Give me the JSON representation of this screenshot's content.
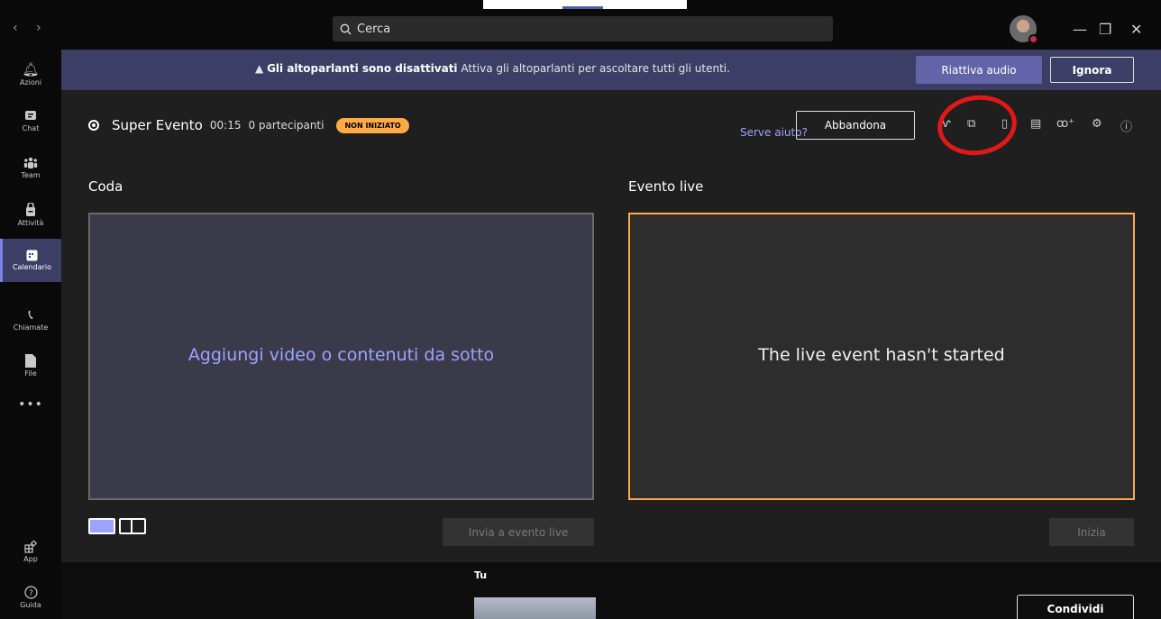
{
  "search": {
    "placeholder": "Cerca"
  },
  "nav": {
    "back": "‹",
    "forward": "›"
  },
  "window": {
    "minimize": "—",
    "maximize": "❐",
    "close": "✕"
  },
  "rail": {
    "items": [
      {
        "label": "Azioni",
        "icon": "bell-icon"
      },
      {
        "label": "Chat",
        "icon": "chat-icon"
      },
      {
        "label": "Team",
        "icon": "team-icon"
      },
      {
        "label": "Attività",
        "icon": "activity-icon"
      },
      {
        "label": "Calendario",
        "icon": "calendar-icon"
      },
      {
        "label": "Chiamate",
        "icon": "phone-icon"
      },
      {
        "label": "File",
        "icon": "file-icon"
      }
    ],
    "more": "•••",
    "bottom": [
      {
        "label": "App",
        "icon": "apps-icon"
      },
      {
        "label": "Guida",
        "icon": "help-icon"
      }
    ]
  },
  "banner": {
    "bold": "Gli altoparlanti sono disattivati",
    "text": " Attiva gli altoparlanti per ascoltare tutti gli utenti.",
    "primary": "Riattiva audio",
    "secondary": "Ignora"
  },
  "event": {
    "name": "Super Evento",
    "time": "00:15",
    "participants": "0 partecipanti",
    "status": "NON INIZIATO",
    "help": "Serve aiuto?",
    "leave": "Abbandona"
  },
  "queue": {
    "label": "Coda",
    "placeholder": "Aggiungi video o contenuti da sotto",
    "send": "Invia a evento live"
  },
  "live": {
    "label": "Evento live",
    "placeholder": "The live event hasn't started",
    "start": "Inizia"
  },
  "bottom": {
    "you": "Tu",
    "share": "Condividi"
  },
  "colors": {
    "accent": "#6264a7",
    "live_border": "#ffaa44",
    "annotation": "#e01818"
  }
}
